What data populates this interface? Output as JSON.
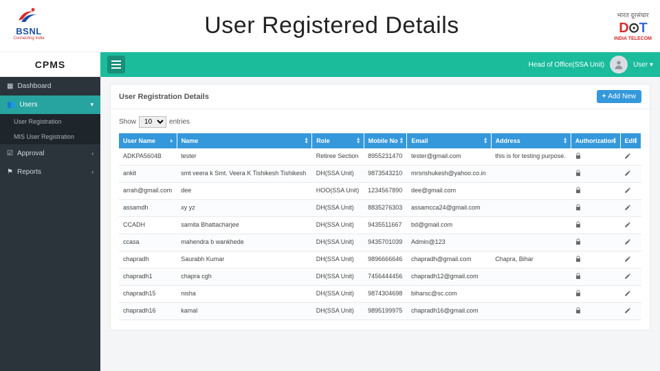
{
  "banner": {
    "bsnl_txt": "BSNL",
    "bsnl_tag": "Connecting India",
    "page_title": "User Registered Details",
    "dot_top": "भारत दूरसंचार",
    "dot_bottom": "INDIA TELECOM"
  },
  "brand": "CPMS",
  "sidebar": {
    "items": [
      {
        "label": "Dashboard",
        "icon": "dash"
      },
      {
        "label": "Users",
        "icon": "users",
        "active": true,
        "expand": "▾"
      },
      {
        "label": "Approval",
        "icon": "check",
        "expand": "‹"
      },
      {
        "label": "Reports",
        "icon": "flag",
        "expand": "‹"
      }
    ],
    "sub": [
      {
        "label": "User Registration"
      },
      {
        "label": "MIS User Registration"
      }
    ]
  },
  "topbar": {
    "role_label": "Head of Office(SSA Unit)",
    "user_menu": "User ▾"
  },
  "panel": {
    "title": "User Registration Details",
    "add_label": "Add New",
    "show_prefix": "Show",
    "show_value": "10",
    "show_suffix": "entries"
  },
  "columns": [
    "User Name",
    "Name",
    "Role",
    "Mobile No",
    "Email",
    "Address",
    "Authorization",
    "Edit"
  ],
  "rows": [
    {
      "user": "ADKPA5604B",
      "name": "tester",
      "role": "Retiree Section",
      "mobile": "8955231470",
      "email": "tester@gmail.com",
      "addr": "this is for testing purpose."
    },
    {
      "user": "ankit",
      "name": "smt veera k Smt. Veera K Tishikesh Tishikesh",
      "role": "DH(SSA Unit)",
      "mobile": "9873543210",
      "email": "mrsrishukesh@yahoo.co.in",
      "addr": ""
    },
    {
      "user": "arrah@gmail.com",
      "name": "dee",
      "role": "HOO(SSA Unit)",
      "mobile": "1234567890",
      "email": "dee@gmail.com",
      "addr": ""
    },
    {
      "user": "assamdh",
      "name": "xy yz",
      "role": "DH(SSA Unit)",
      "mobile": "8835276303",
      "email": "assamcca24@gmail.com",
      "addr": ""
    },
    {
      "user": "CCADH",
      "name": "samita Bhattacharjee",
      "role": "DH(SSA Unit)",
      "mobile": "9435511667",
      "email": "bd@gmail.com",
      "addr": ""
    },
    {
      "user": "ccasa",
      "name": "mahendra b wankhede",
      "role": "DH(SSA Unit)",
      "mobile": "9435701039",
      "email": "Admin@123",
      "addr": ""
    },
    {
      "user": "chapradh",
      "name": "Saurabh Kumar",
      "role": "DH(SSA Unit)",
      "mobile": "9896666646",
      "email": "chapradh@gmail.com",
      "addr": "Chapra, Bihar"
    },
    {
      "user": "chapradh1",
      "name": "chapra cgh",
      "role": "DH(SSA Unit)",
      "mobile": "7456444456",
      "email": "chapradh12@gmail.com",
      "addr": ""
    },
    {
      "user": "chapradh15",
      "name": "nisha",
      "role": "DH(SSA Unit)",
      "mobile": "9874304698",
      "email": "biharsc@sc.com",
      "addr": ""
    },
    {
      "user": "chapradh16",
      "name": "kamal",
      "role": "DH(SSA Unit)",
      "mobile": "9895199975",
      "email": "chapradh16@gmail.com",
      "addr": ""
    }
  ]
}
